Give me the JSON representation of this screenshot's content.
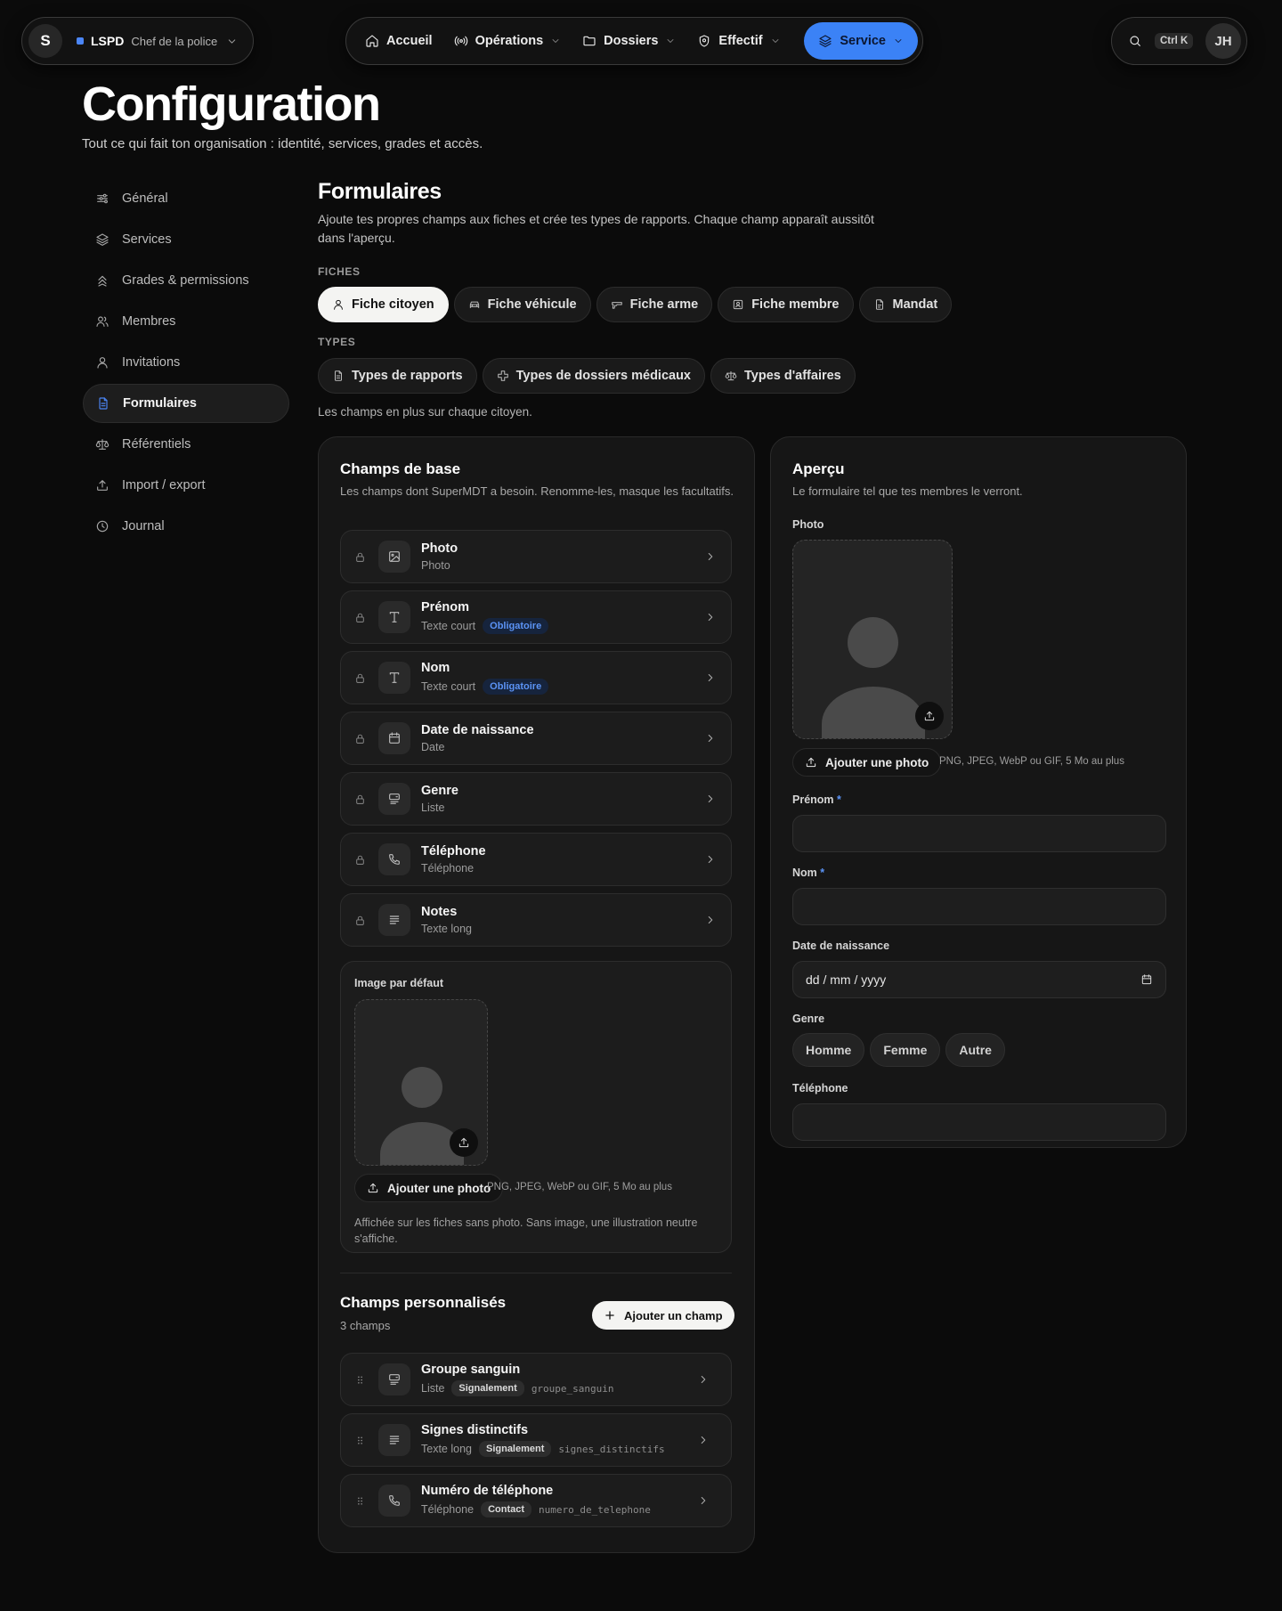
{
  "topbar": {
    "org": {
      "initial": "S",
      "name": "LSPD",
      "role": "Chef de la police"
    },
    "nav": [
      {
        "label": "Accueil",
        "icon": "home-icon"
      },
      {
        "label": "Opérations",
        "icon": "radio-icon"
      },
      {
        "label": "Dossiers",
        "icon": "folder-icon"
      },
      {
        "label": "Effectif",
        "icon": "shield-icon"
      },
      {
        "label": "Service",
        "icon": "layers-icon",
        "active": true
      }
    ],
    "search_shortcut": "Ctrl K",
    "user_initials": "JH"
  },
  "page": {
    "title": "Configuration",
    "subtitle": "Tout ce qui fait ton organisation : identité, services, grades et accès."
  },
  "sidebar": {
    "items": [
      {
        "label": "Général",
        "icon": "sliders-icon"
      },
      {
        "label": "Services",
        "icon": "layers-icon"
      },
      {
        "label": "Grades & permissions",
        "icon": "chevrons-up-icon"
      },
      {
        "label": "Membres",
        "icon": "users-icon"
      },
      {
        "label": "Invitations",
        "icon": "user-icon"
      },
      {
        "label": "Formulaires",
        "icon": "file-text-icon",
        "active": true
      },
      {
        "label": "Référentiels",
        "icon": "scale-icon"
      },
      {
        "label": "Import / export",
        "icon": "upload-icon"
      },
      {
        "label": "Journal",
        "icon": "clock-icon"
      }
    ]
  },
  "section": {
    "title": "Formulaires",
    "description": "Ajoute tes propres champs aux fiches et crée tes types de rapports. Chaque champ apparaît aussitôt dans l'aperçu.",
    "fiches_label": "FICHES",
    "fiches": [
      {
        "label": "Fiche citoyen",
        "icon": "user-icon",
        "active": true
      },
      {
        "label": "Fiche véhicule",
        "icon": "car-icon"
      },
      {
        "label": "Fiche arme",
        "icon": "gun-icon"
      },
      {
        "label": "Fiche membre",
        "icon": "id-card-icon"
      },
      {
        "label": "Mandat",
        "icon": "file-icon"
      }
    ],
    "types_label": "TYPES",
    "types": [
      {
        "label": "Types de rapports",
        "icon": "file-text-icon"
      },
      {
        "label": "Types de dossiers médicaux",
        "icon": "medical-cross-icon"
      },
      {
        "label": "Types d'affaires",
        "icon": "scale-icon"
      }
    ],
    "hint": "Les champs en plus sur chaque citoyen."
  },
  "base_fields": {
    "title": "Champs de base",
    "subtitle": "Les champs dont SuperMDT a besoin. Renomme-les, masque les facultatifs.",
    "required_label": "Obligatoire",
    "items": [
      {
        "name": "Photo",
        "type": "Photo",
        "icon": "image-icon",
        "required": false
      },
      {
        "name": "Prénom",
        "type": "Texte court",
        "icon": "text-icon",
        "required": true
      },
      {
        "name": "Nom",
        "type": "Texte court",
        "icon": "text-icon",
        "required": true
      },
      {
        "name": "Date de naissance",
        "type": "Date",
        "icon": "calendar-icon",
        "required": false
      },
      {
        "name": "Genre",
        "type": "Liste",
        "icon": "list-icon",
        "required": false
      },
      {
        "name": "Téléphone",
        "type": "Téléphone",
        "icon": "phone-icon",
        "required": false
      },
      {
        "name": "Notes",
        "type": "Texte long",
        "icon": "paragraph-icon",
        "required": false
      }
    ]
  },
  "default_image": {
    "label": "Image par défaut",
    "upload_label": "Ajouter une photo",
    "upload_hint": "PNG, JPEG, WebP ou GIF, 5 Mo au plus",
    "note": "Affichée sur les fiches sans photo. Sans image, une illustration neutre s'affiche."
  },
  "custom_fields": {
    "title": "Champs personnalisés",
    "count": "3 champs",
    "add_label": "Ajouter un champ",
    "items": [
      {
        "name": "Groupe sanguin",
        "type": "Liste",
        "tag": "Signalement",
        "key": "groupe_sanguin",
        "icon": "list-icon"
      },
      {
        "name": "Signes distinctifs",
        "type": "Texte long",
        "tag": "Signalement",
        "key": "signes_distinctifs",
        "icon": "paragraph-icon"
      },
      {
        "name": "Numéro de téléphone",
        "type": "Téléphone",
        "tag": "Contact",
        "key": "numero_de_telephone",
        "icon": "phone-icon"
      }
    ]
  },
  "preview": {
    "title": "Aperçu",
    "subtitle": "Le formulaire tel que tes membres le verront.",
    "photo_label": "Photo",
    "upload_label": "Ajouter une photo",
    "upload_hint": "PNG, JPEG, WebP ou GIF, 5 Mo au plus",
    "prenom_label": "Prénom",
    "nom_label": "Nom",
    "required_mark": "*",
    "dob_label": "Date de naissance",
    "dob_placeholder": "dd / mm / yyyy",
    "genre_label": "Genre",
    "genre_options": [
      "Homme",
      "Femme",
      "Autre"
    ],
    "phone_label": "Téléphone"
  },
  "colors": {
    "accent": "#3b82f6",
    "background": "#0b0b0b",
    "card": "#161616"
  }
}
